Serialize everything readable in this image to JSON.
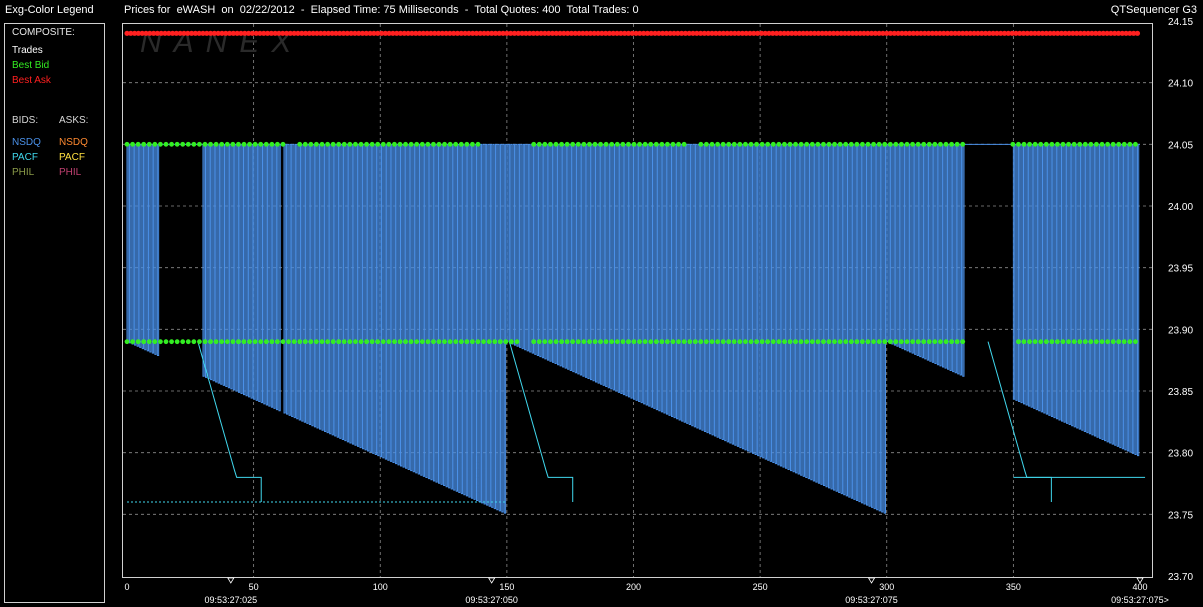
{
  "header": {
    "legend_title": "Exg-Color Legend",
    "chart_title": "Prices for  eWASH  on  02/22/2012  -  Elapsed Time: 75 Milliseconds  -  Total Quotes: 400  Total Trades: 0",
    "app_name": "QTSequencer G3"
  },
  "legend": {
    "composite_label": "COMPOSITE:",
    "trades_label": "Trades",
    "best_bid_label": "Best Bid",
    "best_ask_label": "Best Ask",
    "bids_label": "BIDS:",
    "asks_label": "ASKS:",
    "bids": [
      "NSDQ",
      "PACF",
      "PHIL"
    ],
    "asks": [
      "NSDQ",
      "PACF",
      "PHIL"
    ],
    "colors": {
      "trades": "#ffffff",
      "best_bid": "#33ee22",
      "best_ask": "#ff2020",
      "bid_nsdq": "#4a90e8",
      "bid_pacf": "#40d8ee",
      "bid_phil": "#8a9a48",
      "ask_nsdq": "#ff8a30",
      "ask_pacf": "#ffe040",
      "ask_phil": "#c04070",
      "label": "#d8d8d8"
    }
  },
  "watermark": "NANEX",
  "chart_data": {
    "type": "line",
    "xlim": [
      0,
      400
    ],
    "ylim": [
      23.7,
      24.15
    ],
    "y_ticks": [
      "24.15",
      "24.10",
      "24.05",
      "24.00",
      "23.95",
      "23.90",
      "23.85",
      "23.80",
      "23.75",
      "23.70"
    ],
    "x_ticks": [
      0,
      50,
      100,
      150,
      200,
      250,
      300,
      350,
      400
    ],
    "time_labels": [
      {
        "x": 41,
        "label": "09:53:27:025"
      },
      {
        "x": 144,
        "label": "09:53:27:050"
      },
      {
        "x": 294,
        "label": "09:53:27:075"
      },
      {
        "x": 400,
        "label": "09:53:27:075>"
      }
    ],
    "grid": true,
    "series": [
      {
        "name": "Best Ask",
        "constant": 24.14
      },
      {
        "name": "Best Bid",
        "levels": [
          24.05,
          23.89
        ]
      },
      {
        "name": "NSDQ",
        "levels": [
          24.05,
          23.75
        ]
      },
      {
        "name": "PACF",
        "levels": [
          23.89,
          23.75
        ]
      }
    ]
  }
}
